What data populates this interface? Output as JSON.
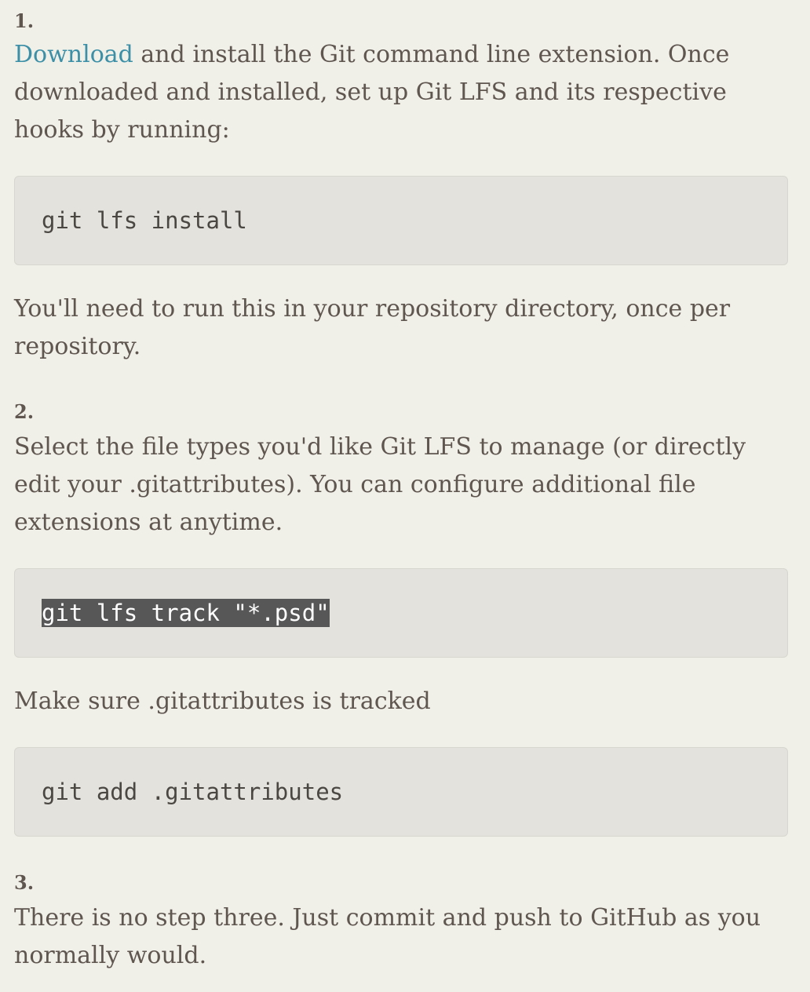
{
  "step1": {
    "number": "1.",
    "link_text": "Download",
    "text": " and install the Git command line extension. Once downloaded and installed, set up Git LFS and its respective hooks by running:",
    "code": "git lfs install",
    "note": "You'll need to run this in your repository directory, once per repository."
  },
  "step2": {
    "number": "2.",
    "text": "Select the file types you'd like Git LFS to manage (or directly edit your .gitattributes). You can configure additional file extensions at anytime.",
    "code": "git lfs track \"*.psd\"",
    "note": "Make sure .gitattributes is tracked",
    "code2": "git add .gitattributes"
  },
  "step3": {
    "number": "3.",
    "text": "There is no step three. Just commit and push to GitHub as you normally would."
  },
  "colors": {
    "background": "#f0efe8",
    "text": "#5f5650",
    "link": "#3b8fa6",
    "code_background": "#e3e2dc",
    "selection_background": "#575757"
  }
}
